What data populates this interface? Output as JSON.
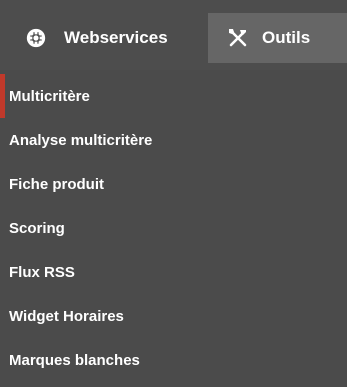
{
  "nav": {
    "tabs": [
      {
        "label": "Webservices",
        "icon": "gear-icon"
      },
      {
        "label": "Outils",
        "icon": "tools-icon"
      }
    ]
  },
  "dropdown": {
    "items": [
      {
        "label": "Multicritère"
      },
      {
        "label": "Analyse multicritère"
      },
      {
        "label": "Fiche produit"
      },
      {
        "label": "Scoring"
      },
      {
        "label": "Flux RSS"
      },
      {
        "label": "Widget Horaires"
      },
      {
        "label": "Marques blanches"
      }
    ]
  },
  "colors": {
    "topbar": "#4d4d4d",
    "outils_tab": "#666666",
    "dropdown_bg": "#4b4b4b",
    "active_marker": "#c0392b",
    "text": "#ffffff"
  }
}
